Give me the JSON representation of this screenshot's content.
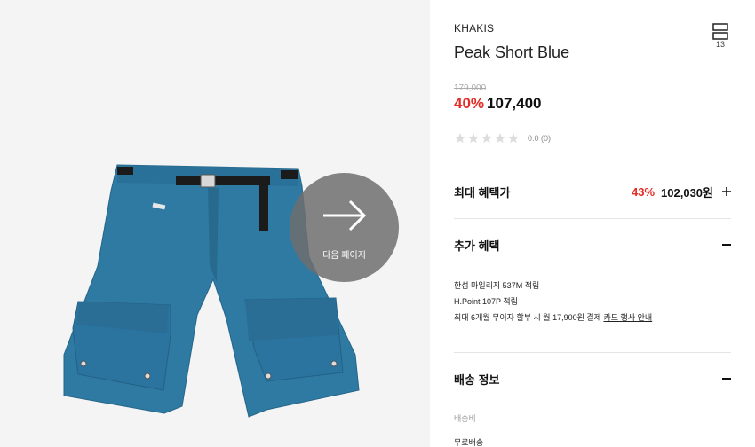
{
  "gallery": {
    "next_label": "다음 페이지",
    "image_alt": "Peak Short Blue product photo"
  },
  "header": {
    "brand": "KHAKIS",
    "title": "Peak Short Blue",
    "cart_count": "13"
  },
  "price": {
    "original": "179,000",
    "discount": "40%",
    "current": "107,400"
  },
  "rating": {
    "text": "0.0 (0)",
    "stars": 5,
    "value": 0
  },
  "max_benefit": {
    "label": "최대 혜택가",
    "discount": "43%",
    "price": "102,030원"
  },
  "extra_benefit": {
    "label": "추가 혜택",
    "line1": "한섬 마일리지 537M 적립",
    "line2": "H.Point 107P 적립",
    "line3_prefix": "최대 6개월 무이자 할부 시 월 17,900원 결제",
    "line3_link": "카드 행사 안내"
  },
  "shipping": {
    "label": "배송 정보",
    "fee_label": "배송비",
    "fee_value": "무료배송"
  },
  "colors": {
    "accent_red": "#e52d27",
    "short_blue": "#2e7aa3"
  }
}
